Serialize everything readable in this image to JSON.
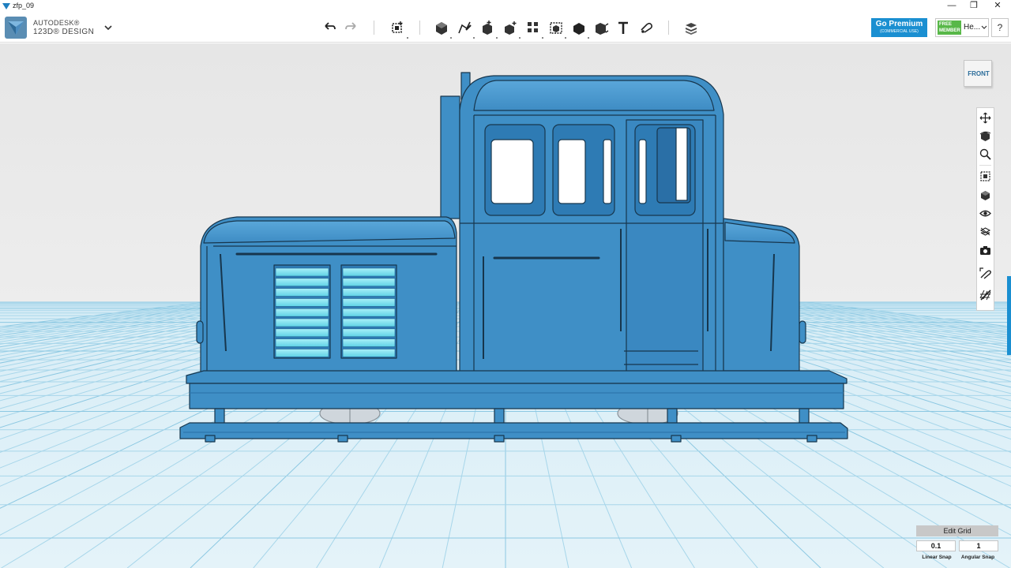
{
  "window": {
    "title": "zfp_09",
    "minimize": "—",
    "maximize": "❐",
    "close": "✕"
  },
  "app": {
    "brand_line1": "AUTODESK®",
    "brand_line2": "123D® DESIGN"
  },
  "toolbar": {
    "tools": [
      "undo-icon",
      "redo-icon",
      "transform-icon",
      "primitives-icon",
      "sketch-icon",
      "construct-icon",
      "modify-icon",
      "pattern-icon",
      "grouping-icon",
      "combine-icon",
      "measure-icon",
      "text-icon",
      "snap-icon",
      "material-icon"
    ]
  },
  "account": {
    "premium_label": "Go Premium",
    "premium_sub": "(COMMERCIAL USE)",
    "member_badge_line1": "FREE",
    "member_badge_line2": "MEMBER",
    "user_name": "He...",
    "help_label": "?"
  },
  "viewcube": {
    "face_label": "FRONT"
  },
  "nav_tools": [
    "pan-icon",
    "orbit-icon",
    "zoom-icon",
    "fit-icon",
    "view-icon",
    "visibility-icon",
    "materials-outline-icon",
    "screenshot-icon",
    "snap-toggle-icon",
    "grid-icon"
  ],
  "grid_panel": {
    "edit_label": "Edit Grid",
    "linear_snap_value": "0.1",
    "angular_snap_value": "1",
    "linear_snap_label": "Linear Snap",
    "angular_snap_label": "Angular Snap"
  },
  "colors": {
    "accent": "#1a8fd1",
    "model": "#3f8fc6",
    "grid_line": "#9ed0e6",
    "background_top": "#e9e9e9",
    "background_floor": "#dbeef6"
  }
}
